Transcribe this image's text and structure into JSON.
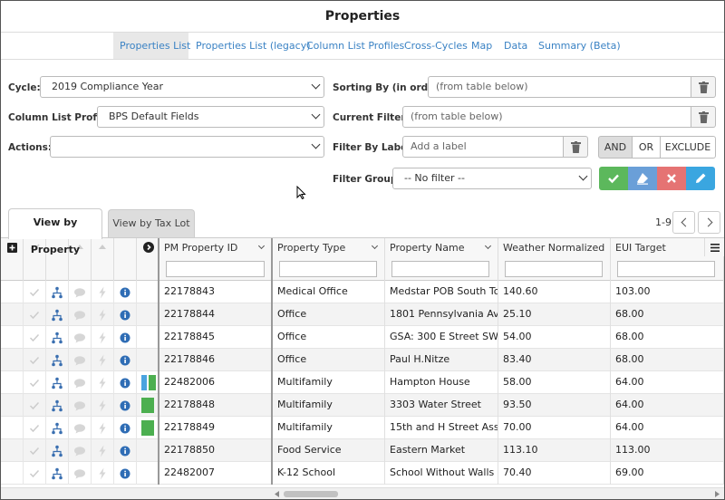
{
  "page": {
    "title": "Properties"
  },
  "subnav": {
    "tabs": [
      {
        "label": "Properties List",
        "active": true
      },
      {
        "label": "Properties List (legacy)",
        "active": false
      },
      {
        "label": "Column List Profiles",
        "active": false
      },
      {
        "label": "Cross-Cycles",
        "active": false
      },
      {
        "label": "Map",
        "active": false
      },
      {
        "label": "Data",
        "active": false
      },
      {
        "label": "Summary (Beta)",
        "active": false
      }
    ]
  },
  "controls": {
    "cycle": {
      "label": "Cycle:",
      "value": "2019 Compliance Year"
    },
    "column_list_profile": {
      "label": "Column List Profile:",
      "value": "BPS Default Fields"
    },
    "actions": {
      "label": "Actions:",
      "value": ""
    },
    "sorting_by": {
      "label": "Sorting By (in order):",
      "placeholder": "(from table below)"
    },
    "current_filters": {
      "label": "Current Filters:",
      "placeholder": "(from table below)"
    },
    "filter_by_label": {
      "label": "Filter By Label:",
      "placeholder": "Add a label"
    },
    "filter_group": {
      "label": "Filter Group:",
      "value": "-- No filter --"
    },
    "logic_buttons": {
      "and": "AND",
      "or": "OR",
      "exclude": "EXCLUDE",
      "active": "AND"
    }
  },
  "colors": {
    "link": "#3a82c4",
    "green": "#5cb85c",
    "blue_light": "#6a9fd8",
    "red_light": "#e57373",
    "blue_cyan": "#3aa6e0",
    "label_green": "#4caf50",
    "label_blue": "#4aa3df"
  },
  "view_tabs": {
    "by_property": "View by Property",
    "by_tax_lot": "View by Tax Lot"
  },
  "pager": {
    "range": "1-9"
  },
  "table": {
    "columns": [
      "PM Property ID",
      "Property Type",
      "Property Name",
      "Weather Normalized Si…",
      "EUI Target"
    ],
    "rows": [
      {
        "id": "22178843",
        "type": "Medical Office",
        "name": "Medstar POB South To…",
        "wn": "140.60",
        "eui": "103.00",
        "labels": []
      },
      {
        "id": "22178844",
        "type": "Office",
        "name": "1801 Pennsylvania Ave…",
        "wn": "25.10",
        "eui": "68.00",
        "labels": []
      },
      {
        "id": "22178845",
        "type": "Office",
        "name": "GSA: 300 E Street SW",
        "wn": "54.00",
        "eui": "68.00",
        "labels": []
      },
      {
        "id": "22178846",
        "type": "Office",
        "name": "Paul H.Nitze",
        "wn": "83.40",
        "eui": "68.00",
        "labels": []
      },
      {
        "id": "22482006",
        "type": "Multifamily",
        "name": "Hampton House",
        "wn": "58.00",
        "eui": "64.00",
        "labels": [
          "blue",
          "green"
        ]
      },
      {
        "id": "22178848",
        "type": "Multifamily",
        "name": "3303 Water Street",
        "wn": "93.50",
        "eui": "64.00",
        "labels": [
          "green"
        ]
      },
      {
        "id": "22178849",
        "type": "Multifamily",
        "name": "15th and H Street Asso…",
        "wn": "70.00",
        "eui": "64.00",
        "labels": [
          "green"
        ]
      },
      {
        "id": "22178850",
        "type": "Food Service",
        "name": "Eastern Market",
        "wn": "113.10",
        "eui": "113.00",
        "labels": []
      },
      {
        "id": "22482007",
        "type": "K-12 School",
        "name": "School Without Walls …",
        "wn": "70.40",
        "eui": "69.00",
        "labels": []
      }
    ]
  }
}
